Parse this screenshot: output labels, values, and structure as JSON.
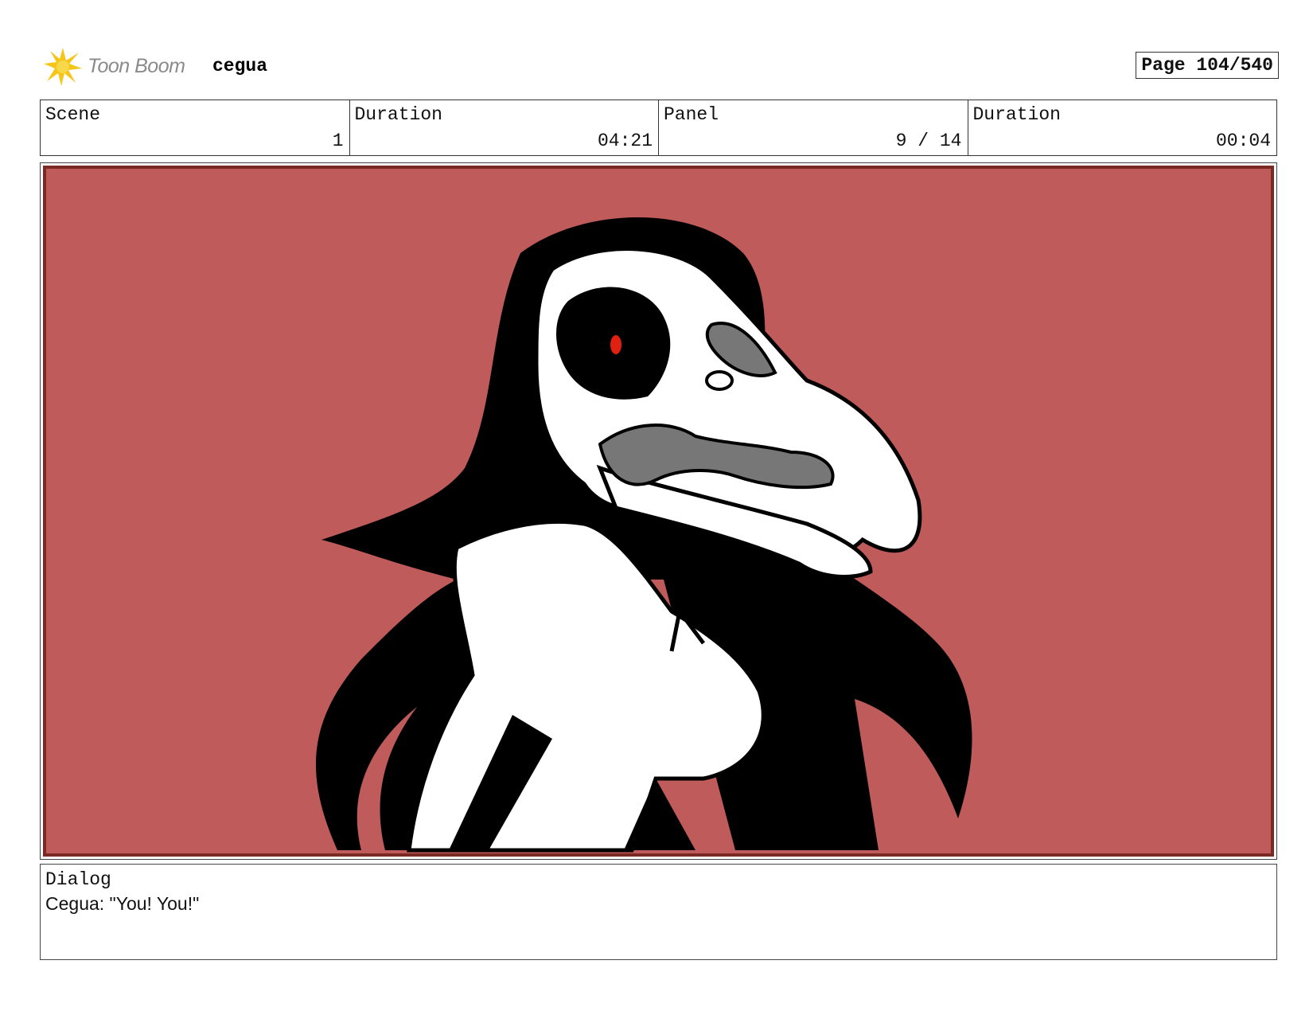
{
  "header": {
    "brand": "Toon Boom",
    "project": "cegua",
    "page": "Page 104/540"
  },
  "info": {
    "scene_label": "Scene",
    "scene_value": "1",
    "scene_duration_label": "Duration",
    "scene_duration_value": "04:21",
    "panel_label": "Panel",
    "panel_value": "9 / 14",
    "panel_duration_label": "Duration",
    "panel_duration_value": "00:04"
  },
  "panel": {
    "background_color": "#bf5b5b",
    "border_color": "#7a2a22",
    "eye_color": "#e02010"
  },
  "dialog": {
    "label": "Dialog",
    "text": "Cegua: \"You! You!\""
  }
}
